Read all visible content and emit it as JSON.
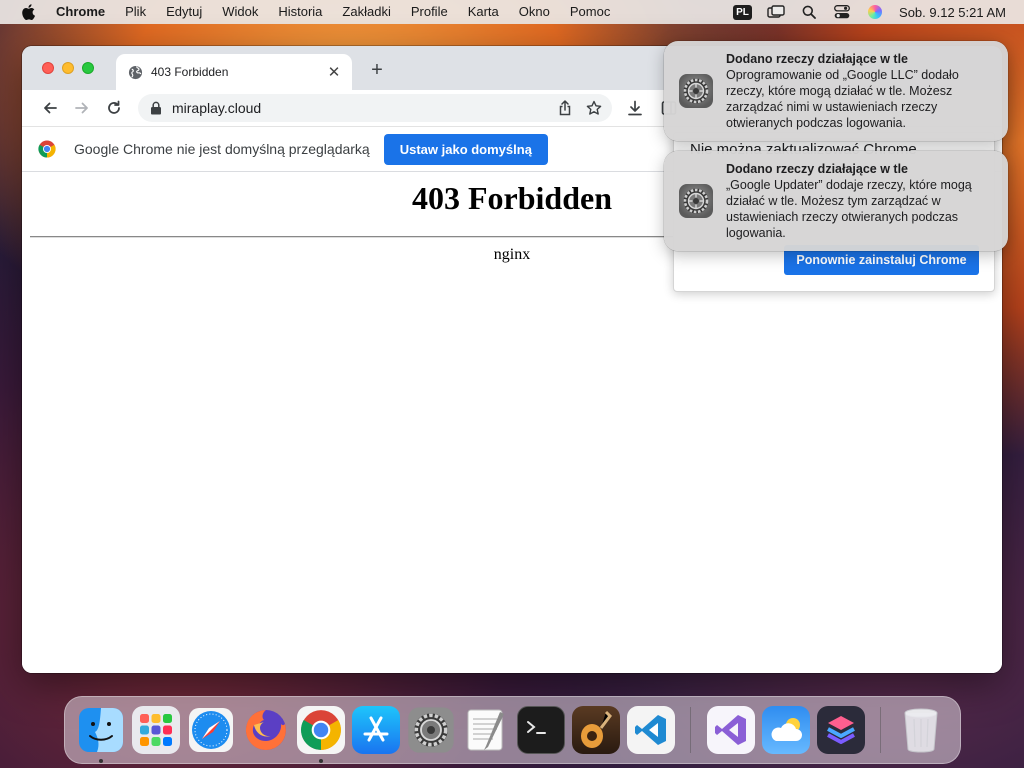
{
  "menubar": {
    "app_name": "Chrome",
    "items": [
      "Plik",
      "Edytuj",
      "Widok",
      "Historia",
      "Zakładki",
      "Profile",
      "Karta",
      "Okno",
      "Pomoc"
    ],
    "status_icons": [
      "keyboard-input-source",
      "screen-mirroring-icon",
      "spotlight-search-icon",
      "control-center-icon",
      "siri-icon"
    ],
    "input_source": "PL",
    "clock": "Sob. 9.12  5:21 AM"
  },
  "browser": {
    "tab": {
      "title": "403 Forbidden",
      "icon": "globe-icon"
    },
    "new_tab_label": "+",
    "address": "miraplay.cloud",
    "toolbar_icons": [
      "share-icon",
      "bookmark-star-icon",
      "download-icon",
      "side-panel-icon"
    ],
    "infobar": {
      "text": "Google Chrome nie jest domyślną przeglądarką",
      "button": "Ustaw jako domyślną"
    },
    "page": {
      "heading": "403 Forbidden",
      "server": "nginx"
    },
    "update_dialog": {
      "title": "Nie można zaktualizować Chrome",
      "button": "Ponownie zainstaluj Chrome"
    }
  },
  "notifications": [
    {
      "title": "Dodano rzeczy działające w tle",
      "body": "Oprogramowanie od „Google LLC” dodało rzeczy, które mogą działać w tle. Możesz zarządzać nimi w ustawieniach rzeczy otwieranych podczas logowania.",
      "icon": "system-settings-gear-icon"
    },
    {
      "title": "Dodano rzeczy działające w tle",
      "body": "„Google Updater” dodaje rzeczy, które mogą działać w tle. Możesz tym zarządzać w ustawieniach rzeczy otwieranych podczas logowania.",
      "icon": "system-settings-gear-icon"
    }
  ],
  "dock": {
    "apps": [
      "Finder",
      "Launchpad",
      "Safari",
      "Firefox",
      "Google Chrome",
      "App Store",
      "System Settings",
      "TextEdit",
      "Terminal",
      "GarageBand",
      "Visual Studio Code"
    ],
    "running": [
      "Finder",
      "Google Chrome"
    ],
    "extras": [
      "Visual Studio",
      "Weather",
      "Shortcuts"
    ],
    "trash": "Trash"
  },
  "colors": {
    "accent": "#1a73e8",
    "notification_bg": "#d6d5d5",
    "tabstrip": "#dee1e6"
  }
}
